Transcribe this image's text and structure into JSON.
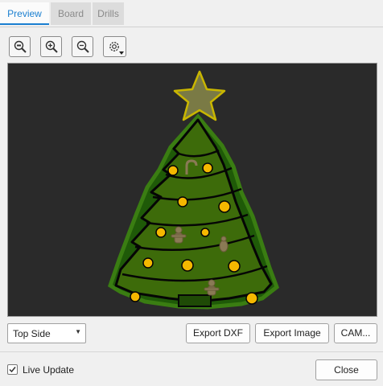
{
  "tabs": [
    {
      "label": "Preview",
      "active": true
    },
    {
      "label": "Board",
      "active": false
    },
    {
      "label": "Drills",
      "active": false
    }
  ],
  "toolbar": {
    "icons": [
      "zoom-fit-icon",
      "zoom-in-icon",
      "zoom-out-icon",
      "settings-gear-icon"
    ]
  },
  "preview": {
    "background_color": "#2a2a2a",
    "tree_fill_color": "#2e6b0a",
    "tree_outline_color": "#3a7d12",
    "ornament_color": "#f5b800",
    "star_color": "#7a7a45"
  },
  "footer": {
    "side_select": "Top Side",
    "export_dxf": "Export DXF",
    "export_image": "Export Image",
    "cam": "CAM...",
    "live_update": "Live Update",
    "live_update_checked": true,
    "close": "Close"
  },
  "accent_color": "#1a7fd0"
}
